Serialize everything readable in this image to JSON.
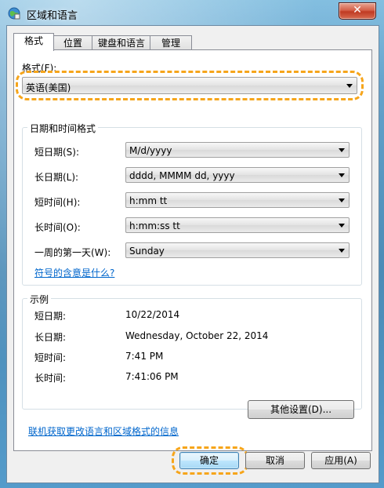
{
  "window": {
    "title": "区域和语言",
    "close_label": "✕"
  },
  "tabs": [
    "格式",
    "位置",
    "键盘和语言",
    "管理"
  ],
  "format": {
    "label": "格式(F):",
    "value": "英语(美国)"
  },
  "datetime_group": {
    "title": "日期和时间格式",
    "rows": [
      {
        "label": "短日期(S):",
        "value": "M/d/yyyy"
      },
      {
        "label": "长日期(L):",
        "value": "dddd, MMMM dd, yyyy"
      },
      {
        "label": "短时间(H):",
        "value": "h:mm tt"
      },
      {
        "label": "长时间(O):",
        "value": "h:mm:ss tt"
      },
      {
        "label": "一周的第一天(W):",
        "value": "Sunday"
      }
    ],
    "link": "符号的含意是什么?"
  },
  "example_group": {
    "title": "示例",
    "rows": [
      {
        "label": "短日期:",
        "value": "10/22/2014"
      },
      {
        "label": "长日期:",
        "value": "Wednesday, October 22, 2014"
      },
      {
        "label": "短时间:",
        "value": "7:41 PM"
      },
      {
        "label": "长时间:",
        "value": "7:41:06 PM"
      }
    ]
  },
  "other_settings": "其他设置(D)...",
  "online_link": "联机获取更改语言和区域格式的信息",
  "buttons": {
    "ok": "确定",
    "cancel": "取消",
    "apply": "应用(A)"
  }
}
